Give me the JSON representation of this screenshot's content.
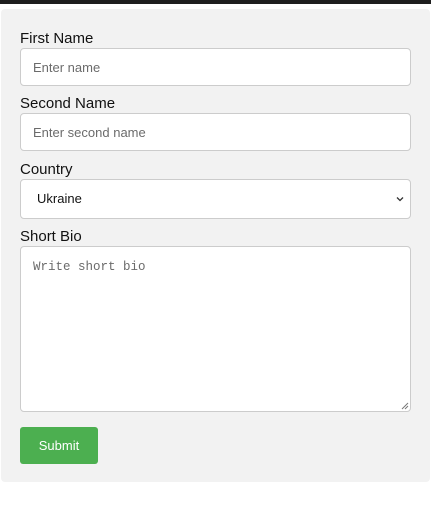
{
  "form": {
    "first_name": {
      "label": "First Name",
      "placeholder": "Enter name",
      "value": ""
    },
    "second_name": {
      "label": "Second Name",
      "placeholder": "Enter second name",
      "value": ""
    },
    "country": {
      "label": "Country",
      "selected": "Ukraine",
      "icon": "chevron-down-icon"
    },
    "bio": {
      "label": "Short Bio",
      "placeholder": "Write short bio",
      "icon": "resize-handle-icon"
    },
    "submit_label": "Submit"
  },
  "colors": {
    "top_bar": "#1e1e1e",
    "panel_background": "#f2f2f2",
    "input_border": "#cccccc",
    "submit_background": "#4caf50",
    "submit_text": "#ffffff"
  }
}
